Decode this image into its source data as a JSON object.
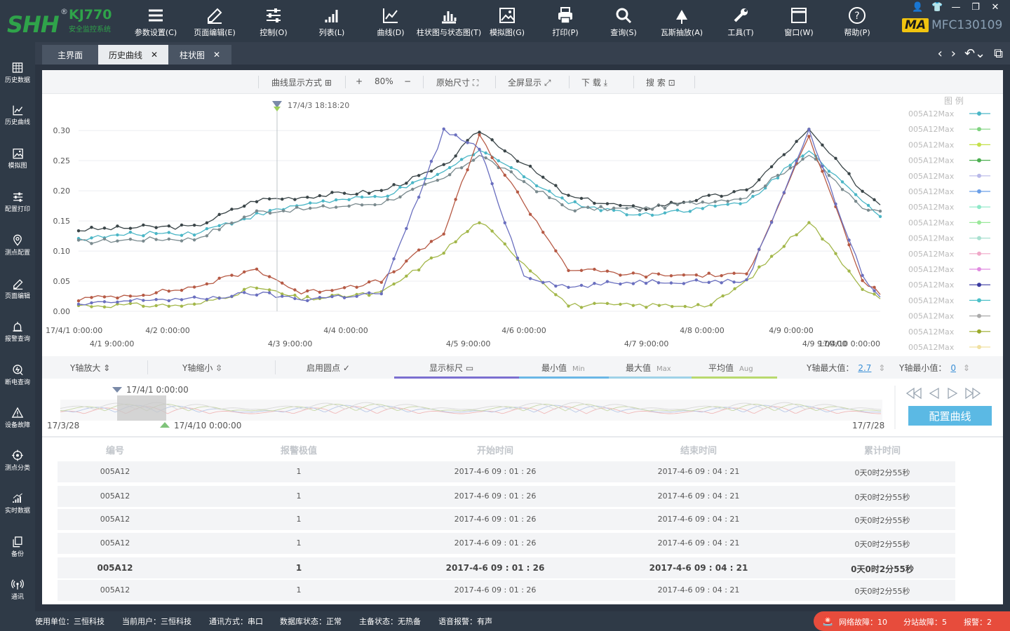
{
  "logo": {
    "brand": "SHH",
    "reg": "®",
    "model": "KJ770",
    "subtitle": "安全监控系统"
  },
  "menu": [
    {
      "label": "参数设置(C)",
      "icon": "list-icon"
    },
    {
      "label": "页面编辑(E)",
      "icon": "edit-icon"
    },
    {
      "label": "控制(O)",
      "icon": "sliders-icon"
    },
    {
      "label": "列表(L)",
      "icon": "bar-signal-icon"
    },
    {
      "label": "曲线(D)",
      "icon": "line-chart-icon"
    },
    {
      "label": "柱状图与状态图(T)",
      "icon": "bar-chart-icon"
    },
    {
      "label": "模拟图(G)",
      "icon": "image-icon"
    },
    {
      "label": "打印(P)",
      "icon": "printer-icon"
    },
    {
      "label": "查询(S)",
      "icon": "search-icon"
    },
    {
      "label": "瓦斯抽放(A)",
      "icon": "drill-icon"
    },
    {
      "label": "工具(T)",
      "icon": "wrench-icon"
    },
    {
      "label": "窗口(W)",
      "icon": "window-icon"
    },
    {
      "label": "帮助(P)",
      "icon": "help-icon"
    }
  ],
  "brand": {
    "ma": "MA",
    "code": "MFC130109"
  },
  "sidebar": [
    {
      "label": "历史数据",
      "icon": "table-icon"
    },
    {
      "label": "历史曲线",
      "icon": "line-chart-icon"
    },
    {
      "label": "模拟图",
      "icon": "image-icon"
    },
    {
      "label": "配置打印",
      "icon": "sliders-icon"
    },
    {
      "label": "测点配置",
      "icon": "location-pin-icon"
    },
    {
      "label": "页面编辑",
      "icon": "edit-icon"
    },
    {
      "label": "报警查询",
      "icon": "alarm-icon"
    },
    {
      "label": "断电查询",
      "icon": "power-search-icon"
    },
    {
      "label": "设备故障",
      "icon": "warning-icon"
    },
    {
      "label": "测点分类",
      "icon": "target-icon"
    },
    {
      "label": "实时数据",
      "icon": "realtime-chart-icon"
    },
    {
      "label": "备份",
      "icon": "copy-icon"
    },
    {
      "label": "通讯",
      "icon": "antenna-icon"
    }
  ],
  "tabs": [
    {
      "label": "主界面",
      "closable": false
    },
    {
      "label": "历史曲线",
      "closable": true,
      "active": true
    },
    {
      "label": "柱状图",
      "closable": true
    }
  ],
  "chart_toolbar": {
    "mode": "曲线显示方式",
    "zoom_in": "+",
    "zoom": "80%",
    "zoom_out": "−",
    "original": "原始尺寸",
    "fullscreen": "全屏显示",
    "download": "下 载",
    "search": "搜 索"
  },
  "chart_data": {
    "type": "line",
    "legend_title": "图 例",
    "cursor_label": "17/4/3  18:18:20",
    "yticks": [
      "0.30",
      "0.25",
      "0.20",
      "0.15",
      "0.10",
      "0.05",
      "0.00"
    ],
    "yvals": [
      0.3,
      0.25,
      0.2,
      0.15,
      0.1,
      0.05,
      0.0
    ],
    "ylim": [
      0,
      0.32
    ],
    "xlim": [
      0,
      9
    ],
    "xticks_top": [
      "17/4/1 0:00:00",
      "4/2 0:00:00",
      "4/4 0:00:00",
      "4/6 0:00:00",
      "4/8 0:00:00",
      "4/9 0:00:00"
    ],
    "xticks_top_pos": [
      0,
      1,
      3,
      5,
      7,
      8
    ],
    "xticks_bottom": [
      "4/1 9:00:00",
      "4/3 9:00:00",
      "4/5 9:00:00",
      "4/7 9:00:00",
      "4/9 9:00:00",
      "17/4/10 0:00:00"
    ],
    "xticks_bottom_pos": [
      0.375,
      2.375,
      4.375,
      6.375,
      8.375,
      9
    ],
    "series": [
      {
        "name": "005A12Max",
        "color": "#3a4548",
        "points": [
          [
            0,
            0.135
          ],
          [
            0.8,
            0.14
          ],
          [
            1.3,
            0.14
          ],
          [
            2,
            0.185
          ],
          [
            2.5,
            0.19
          ],
          [
            3.4,
            0.2
          ],
          [
            4.1,
            0.24
          ],
          [
            4.5,
            0.3
          ],
          [
            5.5,
            0.19
          ],
          [
            6.3,
            0.17
          ],
          [
            7.5,
            0.2
          ],
          [
            8.2,
            0.3
          ],
          [
            8.8,
            0.2
          ],
          [
            9,
            0.18
          ]
        ]
      },
      {
        "name": "005A12Max",
        "color": "#4bb6c6",
        "points": [
          [
            0,
            0.12
          ],
          [
            0.8,
            0.13
          ],
          [
            1.3,
            0.13
          ],
          [
            2,
            0.16
          ],
          [
            2.6,
            0.18
          ],
          [
            3.4,
            0.19
          ],
          [
            4.1,
            0.23
          ],
          [
            4.5,
            0.27
          ],
          [
            5.5,
            0.18
          ],
          [
            6.3,
            0.16
          ],
          [
            7.5,
            0.18
          ],
          [
            8.2,
            0.27
          ],
          [
            8.8,
            0.18
          ],
          [
            9,
            0.16
          ]
        ]
      },
      {
        "name": "005A12Max",
        "color": "#7a8a8e",
        "points": [
          [
            0,
            0.115
          ],
          [
            0.8,
            0.12
          ],
          [
            1.3,
            0.12
          ],
          [
            2,
            0.165
          ],
          [
            2.6,
            0.17
          ],
          [
            3.4,
            0.18
          ],
          [
            4.1,
            0.22
          ],
          [
            4.5,
            0.26
          ],
          [
            5.5,
            0.17
          ],
          [
            6.3,
            0.17
          ],
          [
            7.5,
            0.19
          ],
          [
            8.2,
            0.26
          ],
          [
            8.8,
            0.17
          ],
          [
            9,
            0.17
          ]
        ]
      },
      {
        "name": "005A12Max",
        "color": "#b65a45",
        "points": [
          [
            0,
            0.02
          ],
          [
            0.8,
            0.03
          ],
          [
            1.3,
            0.04
          ],
          [
            2,
            0.07
          ],
          [
            2.5,
            0.03
          ],
          [
            3.4,
            0.05
          ],
          [
            4.1,
            0.13
          ],
          [
            4.5,
            0.29
          ],
          [
            5.5,
            0.07
          ],
          [
            6.3,
            0.06
          ],
          [
            7.5,
            0.06
          ],
          [
            8.2,
            0.29
          ],
          [
            8.8,
            0.05
          ],
          [
            9,
            0.03
          ]
        ]
      },
      {
        "name": "005A12Max",
        "color": "#a3b74a",
        "points": [
          [
            0,
            0.01
          ],
          [
            0.8,
            0.01
          ],
          [
            1.3,
            0.01
          ],
          [
            2,
            0.04
          ],
          [
            2.5,
            0.02
          ],
          [
            3.4,
            0.03
          ],
          [
            4.1,
            0.1
          ],
          [
            4.5,
            0.15
          ],
          [
            5,
            0.08
          ],
          [
            5.5,
            0.01
          ],
          [
            6.3,
            0.01
          ],
          [
            7.1,
            0.01
          ],
          [
            7.5,
            0.05
          ],
          [
            8.2,
            0.15
          ],
          [
            8.8,
            0.04
          ],
          [
            9,
            0.02
          ]
        ]
      },
      {
        "name": "005A12Max",
        "color": "#6a6fbf",
        "points": [
          [
            0,
            0.01
          ],
          [
            0.8,
            0.02
          ],
          [
            1.3,
            0.02
          ],
          [
            2,
            0.03
          ],
          [
            2.5,
            0.02
          ],
          [
            3.4,
            0.03
          ],
          [
            4.1,
            0.3
          ],
          [
            4.5,
            0.27
          ],
          [
            5,
            0.06
          ],
          [
            5.5,
            0.04
          ],
          [
            6.3,
            0.05
          ],
          [
            7.5,
            0.05
          ],
          [
            8.2,
            0.3
          ],
          [
            8.8,
            0.06
          ],
          [
            9,
            0.02
          ]
        ]
      }
    ],
    "legend": [
      {
        "name": "005A12Max",
        "color": "#4bb6c6"
      },
      {
        "name": "005A12Max",
        "color": "#7fd37f"
      },
      {
        "name": "005A12Max",
        "color": "#c4e04a"
      },
      {
        "name": "005A12Max",
        "color": "#4caf50"
      },
      {
        "name": "005A12Max",
        "color": "#b8b8e8"
      },
      {
        "name": "005A12Max",
        "color": "#6b9fe8"
      },
      {
        "name": "005A12Max",
        "color": "#8ee8c8"
      },
      {
        "name": "005A12Max",
        "color": "#9be89b"
      },
      {
        "name": "005A12Max",
        "color": "#a8e0d0"
      },
      {
        "name": "005A12Max",
        "color": "#f0a8c8"
      },
      {
        "name": "005A12Max",
        "color": "#e08ae0"
      },
      {
        "name": "005A12Max",
        "color": "#3a3aa0"
      },
      {
        "name": "005A12Max",
        "color": "#4bc0c8"
      },
      {
        "name": "005A12Max",
        "color": "#aaaaaa"
      },
      {
        "name": "005A12Max",
        "color": "#9aaa2a"
      },
      {
        "name": "005A12Max",
        "color": "#f0e0a0"
      }
    ]
  },
  "controls": {
    "y_zoom_in": "Y轴放大",
    "y_zoom_out": "Y轴缩小",
    "dots": "启用圆点",
    "ruler": "显示标尺",
    "min": "最小值",
    "min_en": "Min",
    "max": "最大值",
    "max_en": "Max",
    "avg": "平均值",
    "avg_en": "Aug",
    "ymax_label": "Y轴最大值：",
    "ymax_val": "2.7",
    "ymin_label": "Y轴最小值：",
    "ymin_val": "0"
  },
  "overview": {
    "range_start": "17/4/1 0:00:00",
    "range_end": "17/4/10 0:00:00",
    "min_date": "17/3/28",
    "max_date": "17/7/28",
    "config_button": "配置曲线"
  },
  "table": {
    "headers": [
      "编号",
      "报警极值",
      "开始时间",
      "结束时间",
      "累计时间"
    ],
    "rows": [
      [
        "005A12",
        "1",
        "2017-4-6    09 : 01 : 26",
        "2017-4-6    09 : 04 : 21",
        "0天0时2分55秒"
      ],
      [
        "005A12",
        "1",
        "2017-4-6    09 : 01 : 26",
        "2017-4-6    09 : 04 : 21",
        "0天0时2分55秒"
      ],
      [
        "005A12",
        "1",
        "2017-4-6    09 : 01 : 26",
        "2017-4-6    09 : 04 : 21",
        "0天0时2分55秒"
      ],
      [
        "005A12",
        "1",
        "2017-4-6    09 : 01 : 26",
        "2017-4-6    09 : 04 : 21",
        "0天0时2分55秒"
      ],
      [
        "005A12",
        "1",
        "2017-4-6    09 : 01 : 26",
        "2017-4-6    09 : 04 : 21",
        "0天0时2分55秒"
      ],
      [
        "005A12",
        "1",
        "2017-4-6    09 : 01 : 26",
        "2017-4-6    09 : 04 : 21",
        "0天0时2分55秒"
      ]
    ]
  },
  "status": {
    "unit": "使用单位：三恒科技",
    "user": "当前用户：三恒科技",
    "comm": "通讯方式：串口",
    "db": "数据库状态：正常",
    "master": "主备状态：无热备",
    "voice": "语音报警：有声"
  },
  "alarms": {
    "network": "网络故障：10",
    "substation": "分站故障：5",
    "alarm": "报警：2"
  }
}
